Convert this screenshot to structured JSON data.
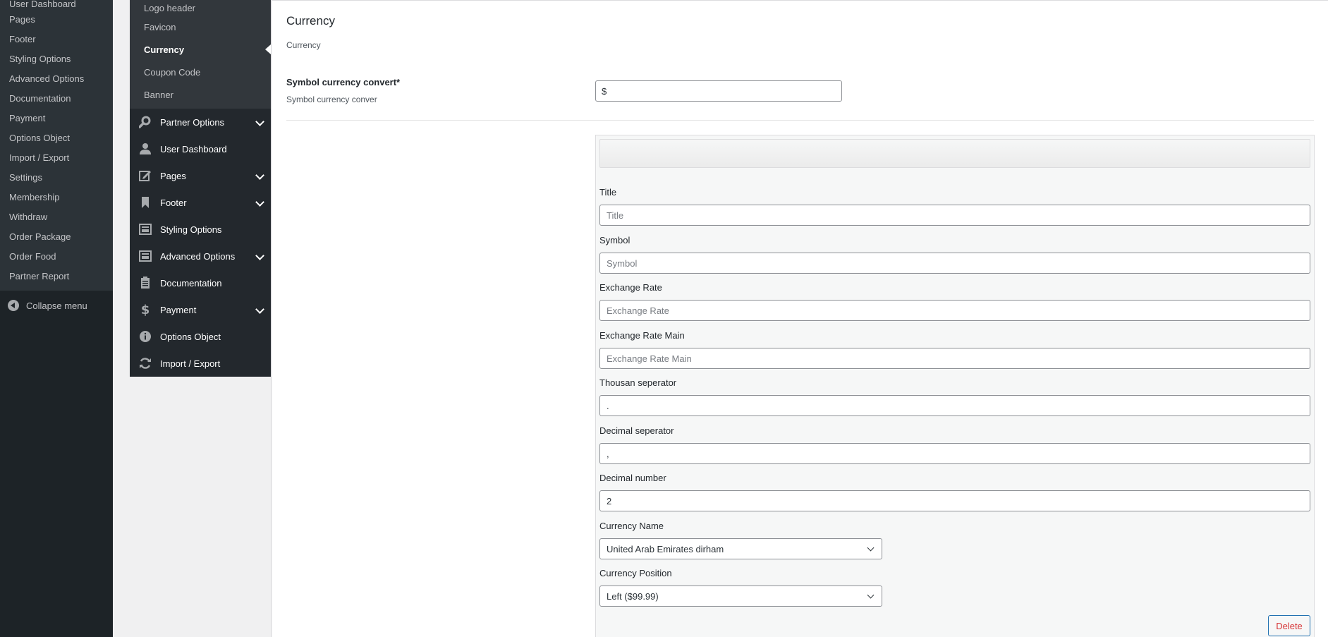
{
  "wp_menu": {
    "items": [
      "User Dashboard",
      "Pages",
      "Footer",
      "Styling Options",
      "Advanced Options",
      "Documentation",
      "Payment",
      "Options Object",
      "Import / Export",
      "Settings",
      "Membership",
      "Withdraw",
      "Order Package",
      "Order Food",
      "Partner Report"
    ],
    "collapse_label": "Collapse menu"
  },
  "options_sidebar": {
    "sub_items": [
      "Logo header",
      "Favicon",
      "Currency",
      "Coupon Code",
      "Banner"
    ],
    "active_sub": "Currency",
    "main_items": [
      {
        "label": "Partner Options",
        "icon": "search-icon",
        "expandable": true
      },
      {
        "label": "User Dashboard",
        "icon": "user-icon",
        "expandable": false
      },
      {
        "label": "Pages",
        "icon": "edit-icon",
        "expandable": true
      },
      {
        "label": "Footer",
        "icon": "bookmark-icon",
        "expandable": true
      },
      {
        "label": "Styling Options",
        "icon": "layout-icon",
        "expandable": false
      },
      {
        "label": "Advanced Options",
        "icon": "layout-icon",
        "expandable": true
      },
      {
        "label": "Documentation",
        "icon": "clipboard-icon",
        "expandable": false
      },
      {
        "label": "Payment",
        "icon": "dollar-icon",
        "expandable": true
      },
      {
        "label": "Options Object",
        "icon": "info-icon",
        "expandable": false
      },
      {
        "label": "Import / Export",
        "icon": "refresh-icon",
        "expandable": false
      }
    ]
  },
  "content": {
    "section_title": "Currency",
    "section_desc": "Currency",
    "symbol_field": {
      "label": "Symbol currency convert*",
      "desc": "Symbol currency conver",
      "value": "$"
    },
    "repeater": {
      "title_label": "Title",
      "title_placeholder": "Title",
      "symbol_label": "Symbol",
      "symbol_placeholder": "Symbol",
      "rate_label": "Exchange Rate",
      "rate_placeholder": "Exchange Rate",
      "rate_main_label": "Exchange Rate Main",
      "rate_main_placeholder": "Exchange Rate Main",
      "thousand_label": "Thousan seperator",
      "thousand_value": ".",
      "decimal_label": "Decimal seperator",
      "decimal_value": ",",
      "decimal_num_label": "Decimal number",
      "decimal_num_value": "2",
      "currency_name_label": "Currency Name",
      "currency_name_value": "United Arab Emirates dirham",
      "currency_position_label": "Currency Position",
      "currency_position_value": "Left ($99.99)",
      "delete_label": "Delete"
    }
  },
  "colors": {
    "admin_bg": "#1d2327",
    "accent": "#2271b1",
    "delete_red": "#d63638"
  }
}
